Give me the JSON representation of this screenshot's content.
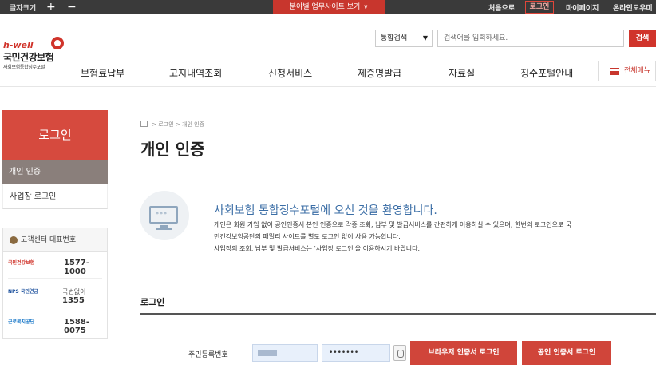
{
  "utility_bar": {
    "font_size_label": "글자크기",
    "font_plus": "+",
    "font_minus": "−",
    "sites_button": "분야별 업무사이트 보기",
    "links": {
      "home": "처음으로",
      "login": "로그인",
      "mypage": "마이페이지",
      "help": "온라인도우미"
    }
  },
  "logo": {
    "brand": "h-well",
    "name": "국민건강보험",
    "sub": "사회보험통합징수포털"
  },
  "search": {
    "scope": "통합검색",
    "placeholder": "검색어를 입력하세요.",
    "button": "검색"
  },
  "gnb": [
    "보험료납부",
    "고지내역조회",
    "신청서비스",
    "제증명발급",
    "자료실",
    "징수포털안내"
  ],
  "all_menu": "전체메뉴",
  "sidebar": {
    "title": "로그인",
    "items": [
      {
        "label": "개인 인증",
        "active": true
      },
      {
        "label": "사업장 로그인",
        "active": false
      }
    ],
    "customer_center": {
      "title": "고객센터 대표번호",
      "rows": [
        {
          "org": "국민건강보험",
          "number": "1577-1000"
        },
        {
          "org": "NPS 국민연금",
          "prefix": "국번없이",
          "number": "1355"
        },
        {
          "org": "근로복지공단",
          "number": "1588-0075"
        }
      ]
    }
  },
  "breadcrumb": [
    "로그인",
    "개인 인증"
  ],
  "page_title": "개인 인증",
  "welcome": {
    "title": "사회보험 통합징수포털에 오신 것을 환영합니다.",
    "lines": [
      "개인은 회원 가입 없이 공인인증서 본인 인증으로 각종 조회, 납부 및 발급서비스를 간편하게 이용하실 수 있으며, 한번의 로그인으로 국",
      "민건강보험공단의 패밀리 사이트를 별도 로그인 없이 사용 가능합니다.",
      "사업장의 조회, 납부 및 발급서비스는 '사업장 로그인'을 이용하시기 바랍니다."
    ]
  },
  "login_form": {
    "heading": "로그인",
    "rrn_label": "주민등록번호",
    "rrn_back_value": "•••••••",
    "browser_cert_button": "브라우저 인증서 로그인",
    "public_cert_button": "공인 인증서 로그인"
  },
  "colors": {
    "accent": "#d0342b",
    "side_active": "#8a7f7b",
    "welcome": "#3b6ea6",
    "topbar": "#3a3a3a"
  },
  "icons": {
    "home": "home-icon",
    "phone": "phone-icon",
    "monitor": "monitor-icon",
    "keypad": "keypad-icon",
    "menu": "hamburger-icon"
  }
}
